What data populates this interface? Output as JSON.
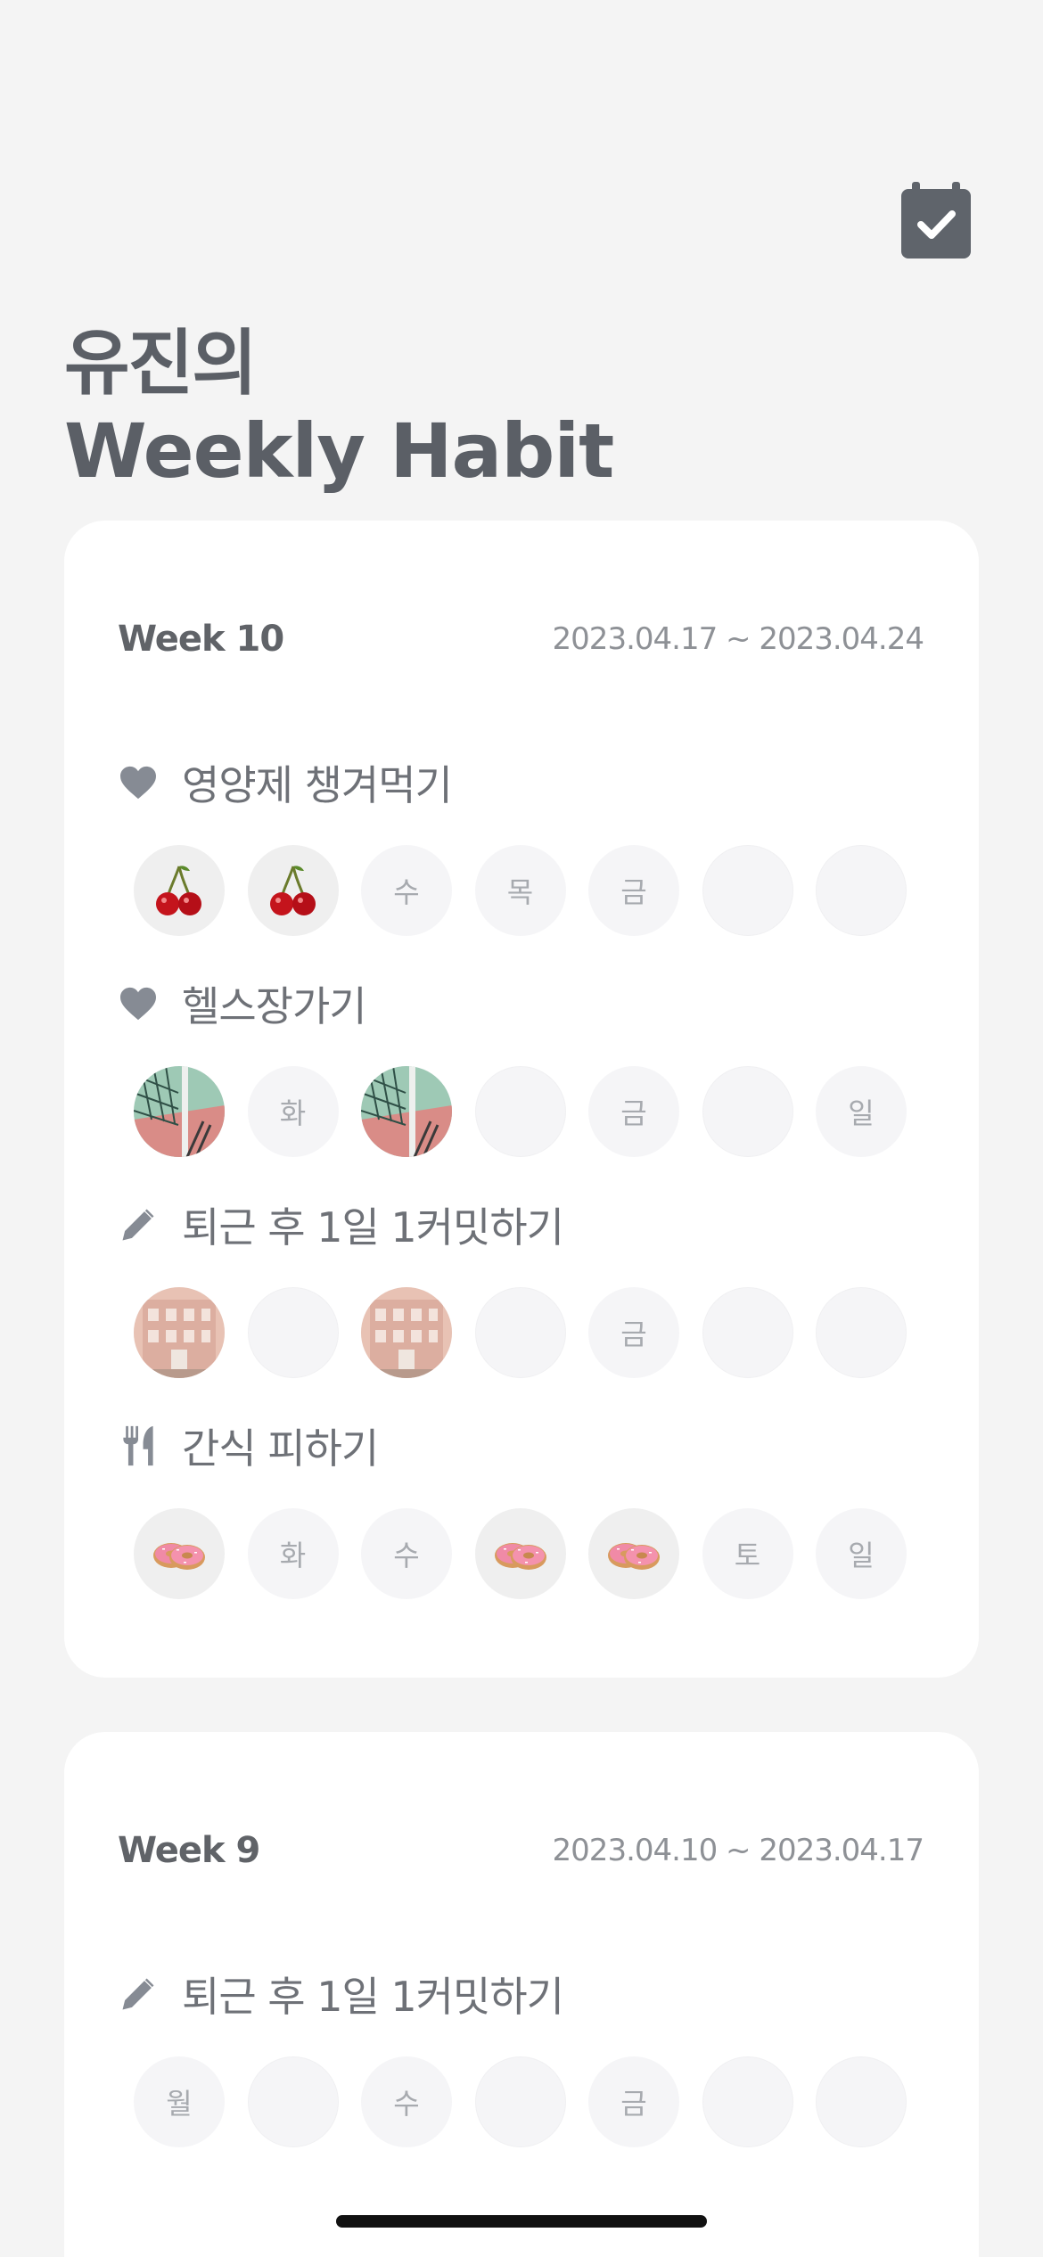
{
  "header": {
    "owner_title": "유진의",
    "headline": "Weekly Habit",
    "calendar_icon": "calendar-check-icon"
  },
  "colors": {
    "background": "#f4f4f4",
    "card": "#ffffff",
    "title": "#5b5f66",
    "icon": "#868b94"
  },
  "weeks": [
    {
      "label": "Week 10",
      "range": "2023.04.17 ~ 2023.04.24",
      "habits": [
        {
          "name": "영양제 챙겨먹기",
          "icon": "heart-icon",
          "days": [
            {
              "state": "done",
              "sticker": "cherry"
            },
            {
              "state": "done",
              "sticker": "cherry"
            },
            {
              "state": "label",
              "text": "수"
            },
            {
              "state": "label",
              "text": "목"
            },
            {
              "state": "label",
              "text": "금"
            },
            {
              "state": "empty"
            },
            {
              "state": "empty"
            }
          ]
        },
        {
          "name": "헬스장가기",
          "icon": "heart-icon",
          "days": [
            {
              "state": "done",
              "sticker": "court-photo"
            },
            {
              "state": "label",
              "text": "화"
            },
            {
              "state": "done",
              "sticker": "court-photo"
            },
            {
              "state": "empty"
            },
            {
              "state": "label",
              "text": "금"
            },
            {
              "state": "empty"
            },
            {
              "state": "label",
              "text": "일"
            }
          ]
        },
        {
          "name": "퇴근 후 1일 1커밋하기",
          "icon": "pencil-icon",
          "days": [
            {
              "state": "done",
              "sticker": "building-photo"
            },
            {
              "state": "empty"
            },
            {
              "state": "done",
              "sticker": "building-photo"
            },
            {
              "state": "empty"
            },
            {
              "state": "label",
              "text": "금"
            },
            {
              "state": "empty"
            },
            {
              "state": "empty"
            }
          ]
        },
        {
          "name": "간식 피하기",
          "icon": "utensils-icon",
          "days": [
            {
              "state": "done",
              "sticker": "donut"
            },
            {
              "state": "label",
              "text": "화"
            },
            {
              "state": "label",
              "text": "수"
            },
            {
              "state": "done",
              "sticker": "donut"
            },
            {
              "state": "done",
              "sticker": "donut"
            },
            {
              "state": "label",
              "text": "토"
            },
            {
              "state": "label",
              "text": "일"
            }
          ]
        }
      ]
    },
    {
      "label": "Week 9",
      "range": "2023.04.10 ~ 2023.04.17",
      "habits": [
        {
          "name": "퇴근 후 1일 1커밋하기",
          "icon": "pencil-icon",
          "days": [
            {
              "state": "label",
              "text": "월"
            },
            {
              "state": "empty"
            },
            {
              "state": "label",
              "text": "수"
            },
            {
              "state": "empty"
            },
            {
              "state": "label",
              "text": "금"
            },
            {
              "state": "empty"
            },
            {
              "state": "empty"
            }
          ]
        }
      ]
    }
  ]
}
